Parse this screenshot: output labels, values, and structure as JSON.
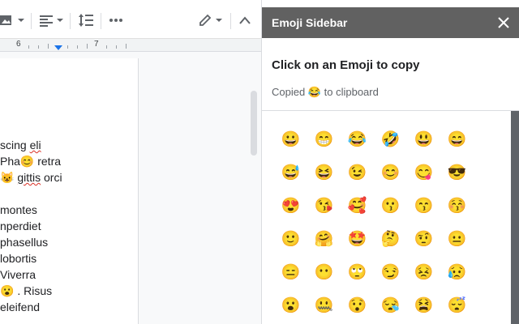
{
  "toolbar": {
    "icons": [
      "image-icon",
      "align-left-icon",
      "line-spacing-icon",
      "more-icon",
      "pencil-icon",
      "collapse-icon"
    ]
  },
  "ruler": {
    "numbers": [
      "6",
      "7"
    ]
  },
  "document": {
    "lines": [
      {
        "pre": "scing ",
        "squiggle": "eli",
        "post": ""
      },
      {
        "pre": "Pha😊 retra",
        "squiggle": "",
        "post": ""
      },
      {
        "pre": "😺 ",
        "squiggle": "gittis",
        "post": " orci"
      },
      {
        "pre": "montes",
        "squiggle": "",
        "post": ""
      },
      {
        "pre": "nperdiet",
        "squiggle": "",
        "post": ""
      },
      {
        "pre": "phasellus",
        "squiggle": "",
        "post": ""
      },
      {
        "pre": "lobortis",
        "squiggle": "",
        "post": ""
      },
      {
        "pre": "Viverra",
        "squiggle": "",
        "post": ""
      },
      {
        "pre": "😮 . Risus",
        "squiggle": "",
        "post": ""
      },
      {
        "pre": "eleifend",
        "squiggle": "",
        "post": ""
      }
    ]
  },
  "sidebar": {
    "title": "Emoji Sidebar",
    "heading": "Click on an Emoji to copy",
    "status_pre": "Copied",
    "status_emoji": "😂",
    "status_post": "to clipboard",
    "header_color": "#616161",
    "emojis": [
      "😀",
      "😁",
      "😂",
      "🤣",
      "😃",
      "😄",
      "😅",
      "😆",
      "😉",
      "😊",
      "😋",
      "😎",
      "😍",
      "😘",
      "🥰",
      "😗",
      "😙",
      "😚",
      "🙂",
      "🤗",
      "🤩",
      "🤔",
      "🤨",
      "😐",
      "😑",
      "😶",
      "🙄",
      "😏",
      "😣",
      "😥",
      "😮",
      "🤐",
      "😯",
      "😪",
      "😫",
      "😴"
    ]
  }
}
